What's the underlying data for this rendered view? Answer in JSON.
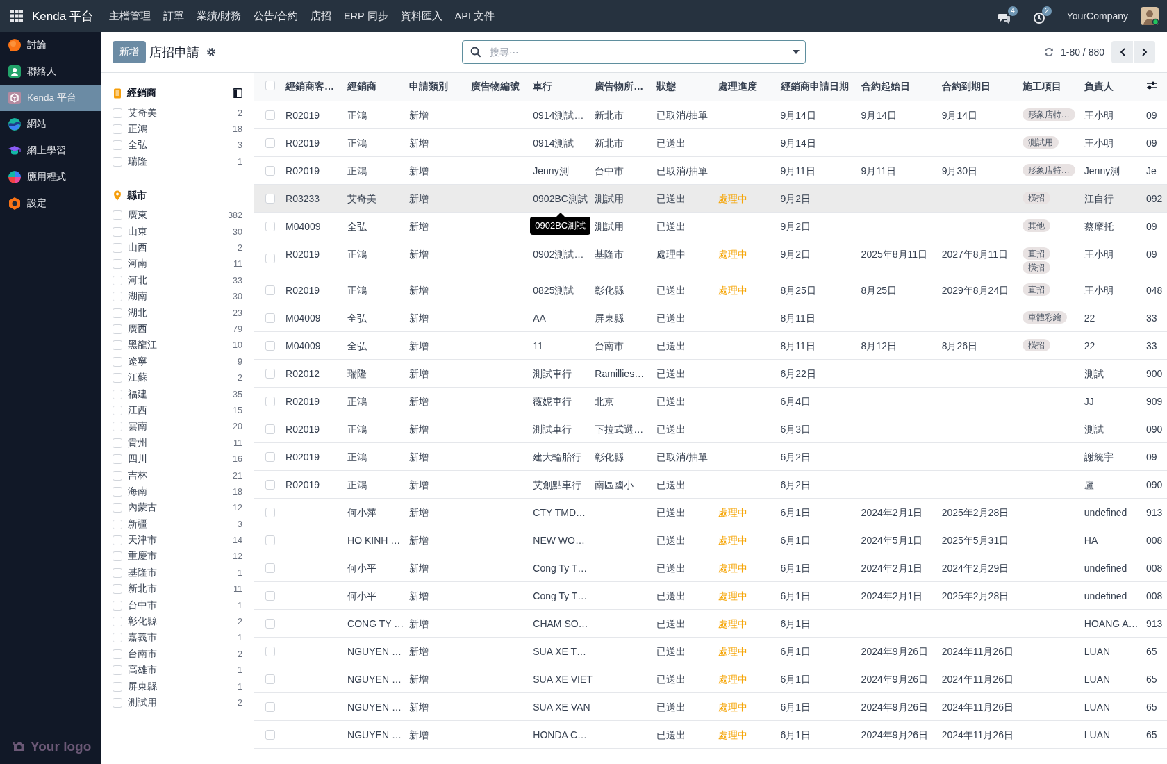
{
  "top_bar": {
    "app_name": "Kenda 平台",
    "menu": [
      "主檔管理",
      "訂單",
      "業績/財務",
      "公告/合約",
      "店招",
      "ERP 同步",
      "資料匯入",
      "API 文件"
    ],
    "chat_count": "4",
    "activity_count": "2",
    "company": "YourCompany"
  },
  "sidebar": {
    "items": [
      {
        "label": "討論",
        "selected": false
      },
      {
        "label": "聯絡人",
        "selected": false
      },
      {
        "label": "Kenda 平台",
        "selected": true
      },
      {
        "label": "網站",
        "selected": false
      },
      {
        "label": "網上學習",
        "selected": false
      },
      {
        "label": "應用程式",
        "selected": false
      },
      {
        "label": "設定",
        "selected": false
      }
    ],
    "logo_text": "Your logo"
  },
  "control_panel": {
    "new_button": "新增",
    "title": "店招申請",
    "search": {
      "placeholder": "搜尋⋯"
    },
    "pager": "1-80 / 880"
  },
  "filters": [
    {
      "title": "經銷商",
      "kind": "dealer",
      "items": [
        {
          "label": "艾奇美",
          "count": "2",
          "checked": false
        },
        {
          "label": "正鴻",
          "count": "18",
          "checked": false
        },
        {
          "label": "全弘",
          "count": "3",
          "checked": false
        },
        {
          "label": "瑞隆",
          "count": "1",
          "checked": false
        }
      ]
    },
    {
      "title": "縣市",
      "kind": "region",
      "items": [
        {
          "label": "廣東",
          "count": "382",
          "checked": false
        },
        {
          "label": "山東",
          "count": "30",
          "checked": false
        },
        {
          "label": "山西",
          "count": "2",
          "checked": false
        },
        {
          "label": "河南",
          "count": "11",
          "checked": false
        },
        {
          "label": "河北",
          "count": "33",
          "checked": false
        },
        {
          "label": "湖南",
          "count": "30",
          "checked": false
        },
        {
          "label": "湖北",
          "count": "23",
          "checked": false
        },
        {
          "label": "廣西",
          "count": "79",
          "checked": false
        },
        {
          "label": "黑龍江",
          "count": "10",
          "checked": false
        },
        {
          "label": "遼寧",
          "count": "9",
          "checked": false
        },
        {
          "label": "江蘇",
          "count": "2",
          "checked": false
        },
        {
          "label": "福建",
          "count": "35",
          "checked": false
        },
        {
          "label": "江西",
          "count": "15",
          "checked": false
        },
        {
          "label": "雲南",
          "count": "20",
          "checked": false
        },
        {
          "label": "貴州",
          "count": "11",
          "checked": false
        },
        {
          "label": "四川",
          "count": "16",
          "checked": false
        },
        {
          "label": "吉林",
          "count": "21",
          "checked": false
        },
        {
          "label": "海南",
          "count": "18",
          "checked": false
        },
        {
          "label": "內蒙古",
          "count": "12",
          "checked": false
        },
        {
          "label": "新疆",
          "count": "3",
          "checked": false
        },
        {
          "label": "天津市",
          "count": "14",
          "checked": false
        },
        {
          "label": "重慶市",
          "count": "12",
          "checked": false
        },
        {
          "label": "基隆市",
          "count": "1",
          "checked": false
        },
        {
          "label": "新北市",
          "count": "11",
          "checked": false
        },
        {
          "label": "台中市",
          "count": "1",
          "checked": false
        },
        {
          "label": "彰化縣",
          "count": "2",
          "checked": false
        },
        {
          "label": "嘉義市",
          "count": "1",
          "checked": false
        },
        {
          "label": "台南市",
          "count": "2",
          "checked": false
        },
        {
          "label": "高雄市",
          "count": "1",
          "checked": false
        },
        {
          "label": "屏東縣",
          "count": "1",
          "checked": false
        },
        {
          "label": "測試用",
          "count": "2",
          "checked": false
        }
      ]
    }
  ],
  "table": {
    "all_checked": false,
    "columns": [
      "經銷商客…",
      "經銷商",
      "申請類別",
      "廣告物編號",
      "車行",
      "廣告物所…",
      "狀態",
      "處理進度",
      "經銷商申請日期",
      "合約起始日",
      "合約到期日",
      "施工項目",
      "負責人"
    ],
    "rows": [
      {
        "checked": false,
        "hovered": false,
        "code": "R02019",
        "dealer": "正鴻",
        "type": "新增",
        "shop": "0914測試…",
        "location": "新北市",
        "status": "已取消/抽單",
        "apply_date": "9月14日",
        "start_date": "9月14日",
        "end_date": "9月14日",
        "works": [
          "形象店特…"
        ],
        "owner": "王小明",
        "column_14": "09"
      },
      {
        "checked": false,
        "hovered": false,
        "code": "R02019",
        "dealer": "正鴻",
        "type": "新增",
        "shop": "0914測試",
        "location": "新北市",
        "status": "已送出",
        "apply_date": "9月14日",
        "works": [
          "測試用"
        ],
        "owner": "王小明",
        "column_14": "09"
      },
      {
        "checked": false,
        "hovered": false,
        "code": "R02019",
        "dealer": "正鴻",
        "type": "新增",
        "shop": "Jenny測",
        "location": "台中市",
        "status": "已取消/抽單",
        "apply_date": "9月11日",
        "start_date": "9月11日",
        "end_date": "9月30日",
        "works": [
          "形象店特…"
        ],
        "owner": "Jenny測",
        "column_14": "Je"
      },
      {
        "checked": false,
        "hovered": true,
        "code": "R03233",
        "dealer": "艾奇美",
        "type": "新增",
        "shop": "0902BC測試",
        "tooltip": "0902BC測試",
        "location": "測試用",
        "status": "已送出",
        "progress": "處理中",
        "apply_date": "9月2日",
        "works": [
          "橫招"
        ],
        "owner": "江自行",
        "column_14": "092"
      },
      {
        "checked": false,
        "hovered": false,
        "code": "M04009",
        "dealer": "全弘",
        "type": "新增",
        "location": "測試用",
        "status": "已送出",
        "apply_date": "9月2日",
        "works": [
          "其他"
        ],
        "owner": "蔡摩托",
        "column_14": "09"
      },
      {
        "checked": false,
        "hovered": false,
        "code": "R02019",
        "dealer": "正鴻",
        "type": "新增",
        "shop": "0902測試…",
        "location": "基隆市",
        "status": "處理中",
        "progress": "處理中",
        "apply_date": "9月2日",
        "start_date": "2025年8月11日",
        "end_date": "2027年8月11日",
        "works": [
          "直招",
          "橫招"
        ],
        "owner": "王小明",
        "column_14": "09"
      },
      {
        "checked": false,
        "hovered": false,
        "code": "R02019",
        "dealer": "正鴻",
        "type": "新增",
        "shop": "0825測試",
        "location": "彰化縣",
        "status": "已送出",
        "progress": "處理中",
        "apply_date": "8月25日",
        "start_date": "8月25日",
        "end_date": "2029年8月24日",
        "works": [
          "直招"
        ],
        "owner": "王小明",
        "column_14": "048"
      },
      {
        "checked": false,
        "hovered": false,
        "code": "M04009",
        "dealer": "全弘",
        "type": "新增",
        "shop": "AA",
        "location": "屏東縣",
        "status": "已送出",
        "apply_date": "8月11日",
        "works": [
          "車體彩繪"
        ],
        "owner": "22",
        "column_14": "33"
      },
      {
        "checked": false,
        "hovered": false,
        "code": "M04009",
        "dealer": "全弘",
        "type": "新增",
        "shop": "11",
        "location": "台南市",
        "status": "已送出",
        "apply_date": "8月11日",
        "start_date": "8月12日",
        "end_date": "8月26日",
        "works": [
          "橫招"
        ],
        "owner": "22",
        "column_14": "33"
      },
      {
        "checked": false,
        "hovered": false,
        "code": "R02012",
        "dealer": "瑞隆",
        "type": "新增",
        "shop": "測試車行",
        "location": "Ramillies…",
        "status": "已送出",
        "apply_date": "6月22日",
        "owner": "測試",
        "column_14": "900"
      },
      {
        "checked": false,
        "hovered": false,
        "code": "R02019",
        "dealer": "正鴻",
        "type": "新增",
        "shop": "薇妮車行",
        "location": "北京",
        "status": "已送出",
        "apply_date": "6月4日",
        "owner": "JJ",
        "column_14": "909"
      },
      {
        "checked": false,
        "hovered": false,
        "code": "R02019",
        "dealer": "正鴻",
        "type": "新增",
        "shop": "測試車行",
        "location": "下拉式選…",
        "status": "已送出",
        "apply_date": "6月3日",
        "owner": "測試",
        "column_14": "090"
      },
      {
        "checked": false,
        "hovered": false,
        "code": "R02019",
        "dealer": "正鴻",
        "type": "新增",
        "shop": "建大輪胎行",
        "location": "彰化縣",
        "status": "已取消/抽單",
        "apply_date": "6月2日",
        "owner": "謝統宇",
        "column_14": "09"
      },
      {
        "checked": false,
        "hovered": false,
        "code": "R02019",
        "dealer": "正鴻",
        "type": "新增",
        "shop": "艾創點車行",
        "location": "南區國小",
        "status": "已送出",
        "apply_date": "6月2日",
        "owner": "盧",
        "column_14": "090"
      },
      {
        "checked": false,
        "hovered": false,
        "dealer": "何小萍",
        "type": "新增",
        "shop": "CTY TMD…",
        "status": "已送出",
        "progress": "處理中",
        "apply_date": "6月1日",
        "start_date": "2024年2月1日",
        "end_date": "2025年2月28日",
        "owner": "undefined",
        "column_14": "913"
      },
      {
        "checked": false,
        "hovered": false,
        "dealer": "HO KINH …",
        "type": "新增",
        "shop": "NEW WO…",
        "status": "已送出",
        "progress": "處理中",
        "apply_date": "6月1日",
        "start_date": "2024年5月1日",
        "end_date": "2025年5月31日",
        "owner": "HA",
        "column_14": "008"
      },
      {
        "checked": false,
        "hovered": false,
        "dealer": "何小平",
        "type": "新增",
        "shop": "Cong Ty T…",
        "status": "已送出",
        "progress": "處理中",
        "apply_date": "6月1日",
        "start_date": "2024年2月1日",
        "end_date": "2024年2月29日",
        "owner": "undefined",
        "column_14": "008"
      },
      {
        "checked": false,
        "hovered": false,
        "dealer": "何小平",
        "type": "新增",
        "shop": "Cong Ty T…",
        "status": "已送出",
        "progress": "處理中",
        "apply_date": "6月1日",
        "start_date": "2024年2月1日",
        "end_date": "2025年2月28日",
        "owner": "undefined",
        "column_14": "008"
      },
      {
        "checked": false,
        "hovered": false,
        "dealer": "CONG TY …",
        "type": "新增",
        "shop": "CHAM SO…",
        "status": "已送出",
        "progress": "處理中",
        "apply_date": "6月1日",
        "owner": "HOANG A…",
        "column_14": "913"
      },
      {
        "checked": false,
        "hovered": false,
        "dealer": "NGUYEN …",
        "type": "新增",
        "shop": "SUA XE T…",
        "status": "已送出",
        "progress": "處理中",
        "apply_date": "6月1日",
        "start_date": "2024年9月26日",
        "end_date": "2024年11月26日",
        "owner": "LUAN",
        "column_14": "65"
      },
      {
        "checked": false,
        "hovered": false,
        "dealer": "NGUYEN …",
        "type": "新增",
        "shop": "SUA XE VIET",
        "status": "已送出",
        "progress": "處理中",
        "apply_date": "6月1日",
        "start_date": "2024年9月26日",
        "end_date": "2024年11月26日",
        "owner": "LUAN",
        "column_14": "65"
      },
      {
        "checked": false,
        "hovered": false,
        "dealer": "NGUYEN …",
        "type": "新增",
        "shop": "SUA XE VAN",
        "status": "已送出",
        "progress": "處理中",
        "apply_date": "6月1日",
        "start_date": "2024年9月26日",
        "end_date": "2024年11月26日",
        "owner": "LUAN",
        "column_14": "65"
      },
      {
        "checked": false,
        "hovered": false,
        "dealer": "NGUYEN …",
        "type": "新增",
        "shop": "HONDA C…",
        "status": "已送出",
        "progress": "處理中",
        "apply_date": "6月1日",
        "start_date": "2024年9月26日",
        "end_date": "2024年11月26日",
        "owner": "LUAN",
        "column_14": "65"
      }
    ]
  }
}
